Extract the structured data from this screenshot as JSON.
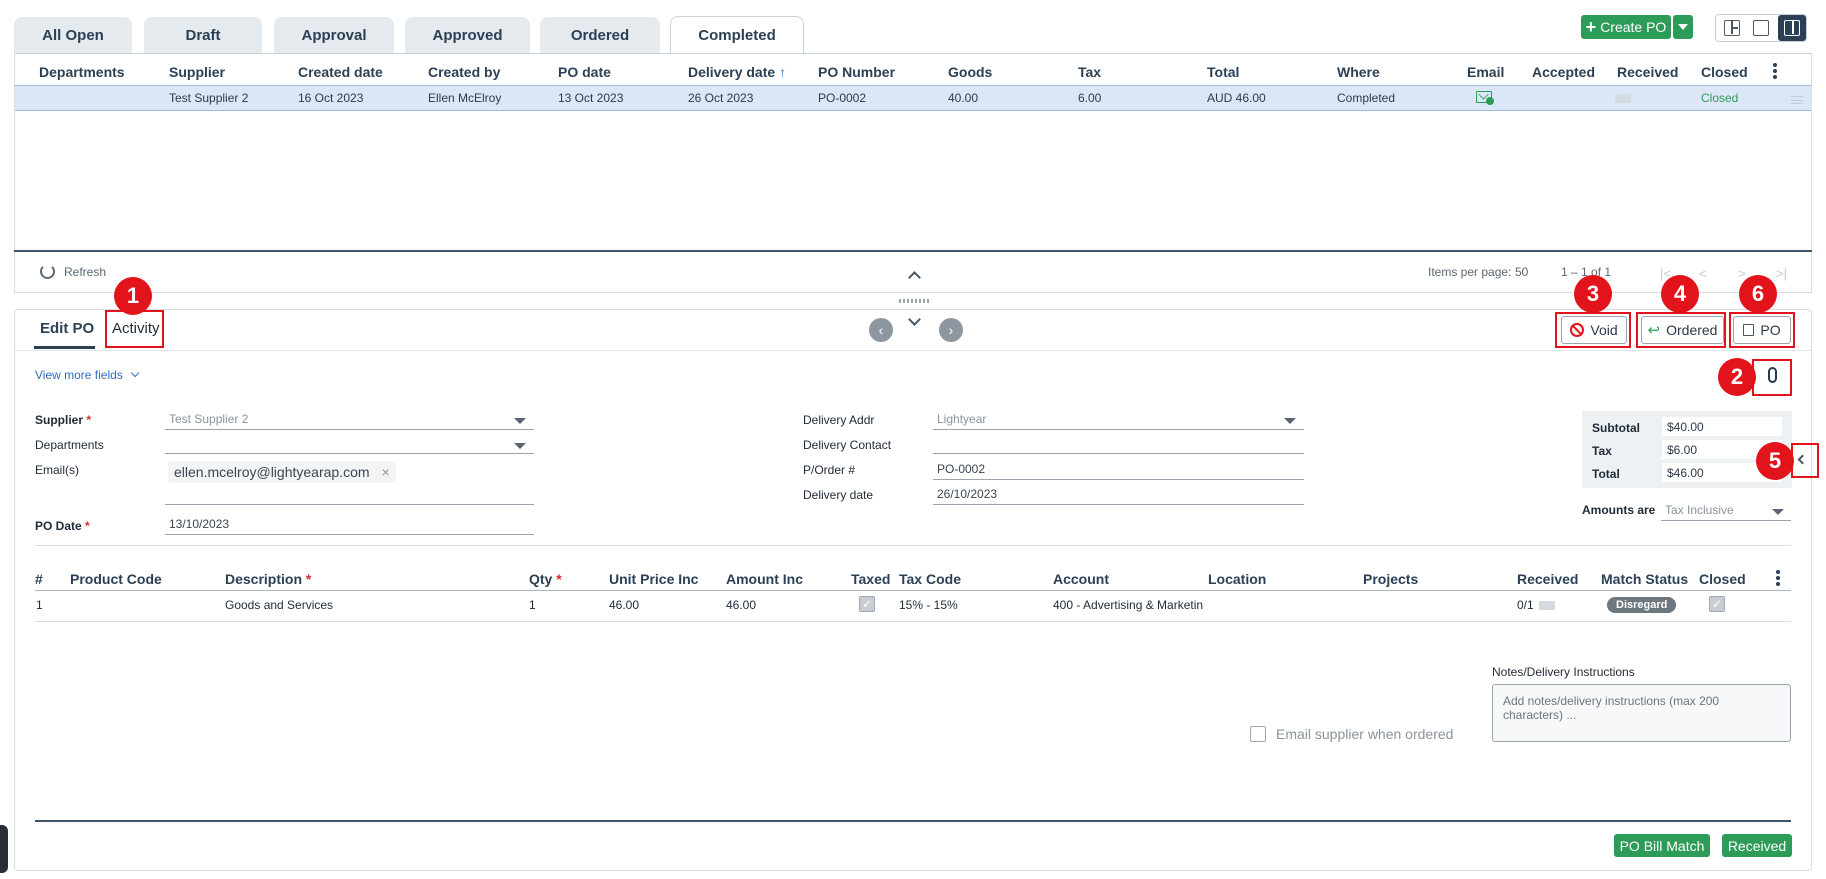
{
  "tabs": [
    "All Open",
    "Draft",
    "Approval",
    "Approved",
    "Ordered",
    "Completed"
  ],
  "toolbar": {
    "create_po": "Create PO"
  },
  "po_table": {
    "headers": [
      "Departments",
      "Supplier",
      "Created date",
      "Created by",
      "PO date",
      "Delivery date",
      "PO Number",
      "Goods",
      "Tax",
      "Total",
      "Where",
      "Email",
      "Accepted",
      "Received",
      "Closed"
    ],
    "sort_indicator": "↑",
    "row": {
      "departments": "",
      "supplier": "Test Supplier 2",
      "created_date": "16 Oct 2023",
      "created_by": "Ellen McElroy",
      "po_date": "13 Oct 2023",
      "delivery_date": "26 Oct 2023",
      "po_number": "PO-0002",
      "goods": "40.00",
      "tax": "6.00",
      "total": "AUD 46.00",
      "where": "Completed",
      "closed": "Closed"
    }
  },
  "pager": {
    "refresh": "Refresh",
    "items_per_page_label": "Items per page:",
    "items_per_page": "50",
    "range": "1 – 1 of 1"
  },
  "detail_tabs": {
    "edit": "Edit PO",
    "activity": "Activity"
  },
  "actions": {
    "void": "Void",
    "ordered": "Ordered",
    "po": "PO"
  },
  "annotations": [
    "1",
    "2",
    "3",
    "4",
    "5",
    "6"
  ],
  "form": {
    "view_more": "View more fields",
    "supplier_label": "Supplier",
    "supplier_value": "Test Supplier 2",
    "departments_label": "Departments",
    "emails_label": "Email(s)",
    "email_chip": "ellen.mcelroy@lightyearap.com",
    "po_date_label": "PO Date",
    "po_date_value": "13/10/2023",
    "delivery_addr_label": "Delivery Addr",
    "delivery_addr_value": "Lightyear",
    "delivery_contact_label": "Delivery Contact",
    "porder_label": "P/Order #",
    "porder_value": "PO-0002",
    "delivery_date_label": "Delivery date",
    "delivery_date_value": "26/10/2023"
  },
  "totals": {
    "subtotal_label": "Subtotal",
    "subtotal": "$40.00",
    "tax_label": "Tax",
    "tax": "$6.00",
    "total_label": "Total",
    "total": "$46.00",
    "amounts_are_label": "Amounts are",
    "amounts_are": "Tax Inclusive"
  },
  "lines": {
    "headers": [
      "#",
      "Product Code",
      "Description",
      "Qty",
      "Unit Price Inc",
      "Amount Inc",
      "Taxed",
      "Tax Code",
      "Account",
      "Location",
      "Projects",
      "Received",
      "Match Status",
      "Closed"
    ],
    "row": {
      "num": "1",
      "product_code": "",
      "description": "Goods and Services",
      "qty": "1",
      "unit_price": "46.00",
      "amount": "46.00",
      "tax_code": "15% - 15%",
      "account": "400 - Advertising & Marketin",
      "received": "0/1",
      "match_status": "Disregard"
    }
  },
  "notes": {
    "label": "Notes/Delivery Instructions",
    "placeholder": "Add notes/delivery instructions (max 200 characters) ..."
  },
  "email_supplier": "Email supplier when ordered",
  "footer": {
    "bill_match": "PO Bill Match",
    "received": "Received"
  },
  "colors": {
    "accent_green": "#2e9c59",
    "annotation_red": "#e3131b",
    "selected_row": "#dbe7f6",
    "closed_text": "#2e9c59"
  }
}
